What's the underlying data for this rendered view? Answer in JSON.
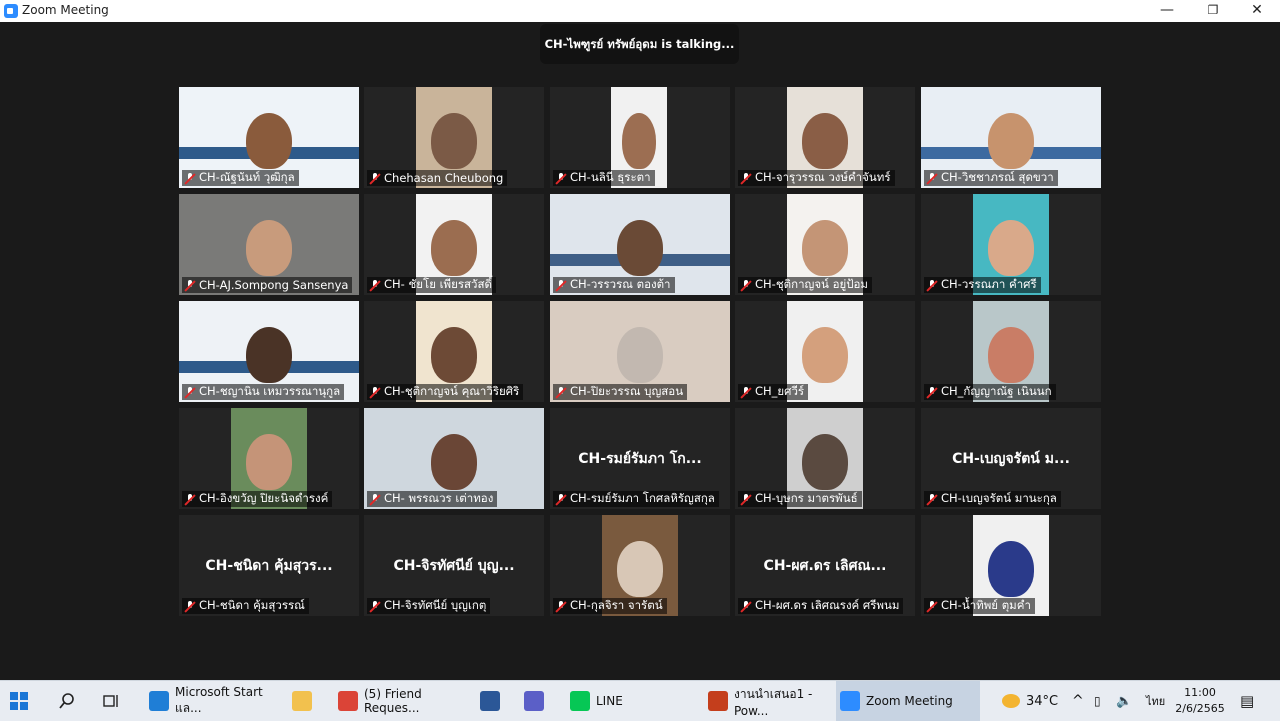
{
  "window": {
    "title": "Zoom Meeting",
    "minimize": "—",
    "restore": "❐",
    "close": "✕"
  },
  "talking_banner": "CH-ไพฑูรย์ ทรัพย์อุดม is  talking...",
  "tiles": [
    {
      "name": "CH-ณัฐนันท์ วุฒิกุล",
      "muted": true
    },
    {
      "name": "Chehasan Cheubong",
      "muted": true
    },
    {
      "name": "CH-นลินี ธุระตา",
      "muted": true
    },
    {
      "name": "CH-จารุวรรณ วงษ์คำจันทร์",
      "muted": true
    },
    {
      "name": "CH-วิชชาภรณ์ สุดขวา",
      "muted": true
    },
    {
      "name": "CH-AJ.Sompong Sansenya",
      "muted": true
    },
    {
      "name": "CH- ชัยโย เพียรสวัสดิ์",
      "muted": true
    },
    {
      "name": "CH-วรรวรณ ตองต้า",
      "muted": true
    },
    {
      "name": "CH-ชุติกาญจน์ อยู่ป้อม",
      "muted": true
    },
    {
      "name": "CH-วรรณภา คำศรี",
      "muted": true
    },
    {
      "name": "CH-ชญานิน เหมวรรณานุกูล",
      "muted": true
    },
    {
      "name": "CH-ชุติกาญจน์ คุณาวิริยศิริ",
      "muted": true
    },
    {
      "name": "CH-ปิยะวรรณ บุญสอน",
      "muted": true
    },
    {
      "name": "CH_ยศวีร์",
      "muted": true
    },
    {
      "name": "CH_กัญญาณัฐ เนินนก",
      "muted": true
    },
    {
      "name": "CH-อิงขวัญ ปิยะนิจดำรงค์",
      "muted": true
    },
    {
      "name": "CH- พรรณวร เต่าทอง",
      "muted": true
    },
    {
      "name": "CH-รมย์รัมภา โกศลหิรัญสกุล",
      "muted": true,
      "big": "CH-รมย์รัมภา โก..."
    },
    {
      "name": "CH-บุษกร มาตรพันธ์",
      "muted": true
    },
    {
      "name": "CH-เบญจรัตน์ มานะกุล",
      "muted": true,
      "big": "CH-เบญจรัตน์ ม..."
    },
    {
      "name": "CH-ชนิดา คุ้มสุวรรณ์",
      "muted": true,
      "big": "CH-ชนิดา คุ้มสุวร..."
    },
    {
      "name": "CH-จิรทัศนีย์ บุญเกตุ",
      "muted": true,
      "big": "CH-จิรทัศนีย์ บุญ..."
    },
    {
      "name": "CH-กุลจิรา จารัตน์",
      "muted": true
    },
    {
      "name": "CH-ผศ.ดร เลิศณรงค์ ศรีพนม",
      "muted": true,
      "big": "CH-ผศ.ดร เลิศณ..."
    },
    {
      "name": "CH-น้ำทิพย์ ตุมคำ",
      "muted": true
    }
  ],
  "taskbar": {
    "apps": [
      {
        "label": "Microsoft Start แล...",
        "icon": "edge-icon",
        "color": "#1f7ed6"
      },
      {
        "label": "",
        "icon": "folder-icon",
        "color": "#f2c14e"
      },
      {
        "label": "(5) Friend Reques...",
        "icon": "chrome-icon",
        "color": "#db4437"
      },
      {
        "label": "",
        "icon": "word-icon",
        "color": "#2b5797"
      },
      {
        "label": "",
        "icon": "teams-icon",
        "color": "#5b5fc7"
      },
      {
        "label": "LINE",
        "icon": "line-icon",
        "color": "#06c755"
      },
      {
        "label": "งานนำเสนอ1 - Pow...",
        "icon": "powerpoint-icon",
        "color": "#c43e1c"
      },
      {
        "label": "Zoom Meeting",
        "icon": "zoom-icon",
        "color": "#2d8cff"
      }
    ],
    "weather": "34°C",
    "language": "ไทย",
    "time": "11:00",
    "date": "2/6/2565"
  },
  "colors": {
    "accent": "#2d8cff",
    "mute_red": "#e02828"
  }
}
